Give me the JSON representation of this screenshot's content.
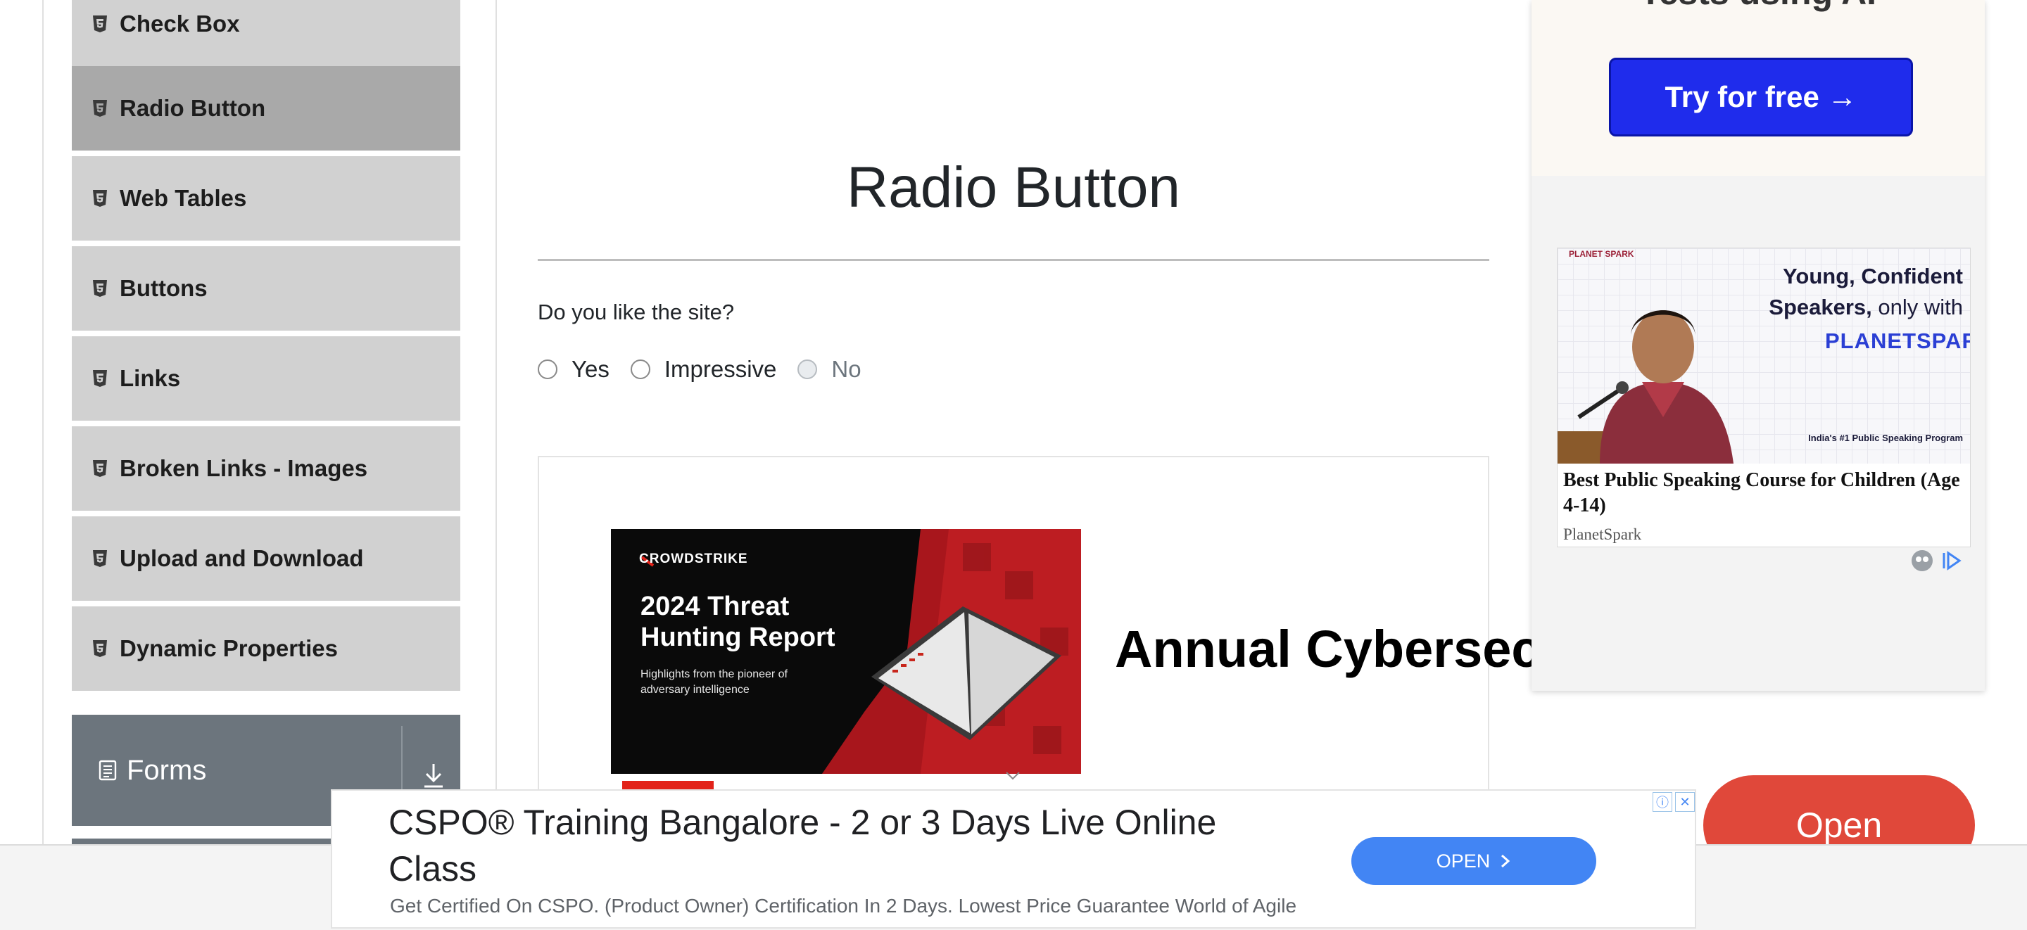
{
  "sidebar": {
    "items": [
      {
        "label": "Check Box"
      },
      {
        "label": "Radio Button",
        "active": true
      },
      {
        "label": "Web Tables"
      },
      {
        "label": "Buttons"
      },
      {
        "label": "Links"
      },
      {
        "label": "Broken Links - Images"
      },
      {
        "label": "Upload and Download"
      },
      {
        "label": "Dynamic Properties"
      }
    ],
    "groups": [
      {
        "label": "Forms",
        "icon": "document-icon",
        "toggle_icon": "download-icon"
      }
    ]
  },
  "main": {
    "title": "Radio Button",
    "question": "Do you like the site?",
    "options": [
      {
        "label": "Yes",
        "disabled": false
      },
      {
        "label": "Impressive",
        "disabled": false
      },
      {
        "label": "No",
        "disabled": true
      }
    ]
  },
  "ad_crowdstrike": {
    "brand": "CROWDSTRIKE",
    "report_title": "2024 Threat Hunting Report",
    "report_sub": "Highlights from the pioneer of adversary intelligence",
    "headline": "Annual Cybersecur"
  },
  "ad_right": {
    "top_text": "Tests using AI",
    "cta": "Try for free →",
    "card": {
      "head_bold": "Young, Confident Speakers,",
      "head_light": "only with",
      "logo": "PLANETSPARK",
      "mini_logo": "PLANET SPARK",
      "tagline": "India's #1 Public Speaking Program",
      "title": "Best Public Speaking Course for Children (Age 4-14)",
      "source": "PlanetSpark"
    }
  },
  "ad_bottom": {
    "title": "CSPO® Training Bangalore - 2 or 3 Days Live Online Class",
    "description": "Get Certified On CSPO. (Product Owner) Certification In 2 Days. Lowest Price Guarantee World of Agile",
    "button": "OPEN",
    "big_button": "Open"
  },
  "colors": {
    "menu_bg": "#d1d1d1",
    "menu_active": "#a9a9a9",
    "group_bg": "#6c757d",
    "ad_blue": "#4285f4",
    "cta_blue": "#1f2cec",
    "open_red": "#e0483a"
  }
}
